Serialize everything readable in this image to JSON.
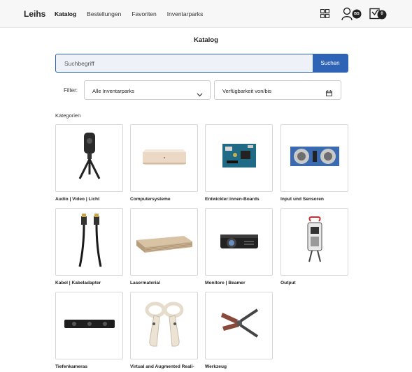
{
  "header": {
    "brand": "Leihs",
    "nav": [
      {
        "label": "Katalog",
        "active": true
      },
      {
        "label": "Bestellungen",
        "active": false
      },
      {
        "label": "Favoriten",
        "active": false
      },
      {
        "label": "Inventarparks",
        "active": false
      }
    ],
    "icons": [
      "grid-icon",
      "user-icon",
      "cart-icon"
    ],
    "user_initials": "BS",
    "cart_count": "0"
  },
  "page_title": "Katalog",
  "search": {
    "placeholder": "Suchbegriff",
    "button_label": "Suchen"
  },
  "filter": {
    "label": "Filter:",
    "pool_select": "Alle Inventarparks",
    "availability": "Verfügbarkeit von/bis"
  },
  "categories": {
    "heading": "Kategorien",
    "items": [
      {
        "label": "Audio | Video | Licht",
        "icon": "camera-icon"
      },
      {
        "label": "Computersysteme",
        "icon": "computer-icon"
      },
      {
        "label": "Entwickler:innen-Boards",
        "icon": "circuit-board-icon"
      },
      {
        "label": "Input und Sensoren",
        "icon": "sensor-icon"
      },
      {
        "label": "Kabel | Kabeladapter",
        "icon": "cable-icon"
      },
      {
        "label": "Lasermaterial",
        "icon": "material-sheets-icon"
      },
      {
        "label": "Monitore | Beamer",
        "icon": "projector-icon"
      },
      {
        "label": "Output",
        "icon": "output-device-icon"
      },
      {
        "label": "Tiefenkameras",
        "icon": "depth-camera-icon"
      },
      {
        "label": "Virtual and Augmented Reali-",
        "icon": "vr-controller-icon"
      },
      {
        "label": "Werkzeug",
        "icon": "pliers-icon"
      }
    ]
  },
  "colors": {
    "accent": "#2f63b6",
    "topbar_bg": "#f7f7f7"
  }
}
